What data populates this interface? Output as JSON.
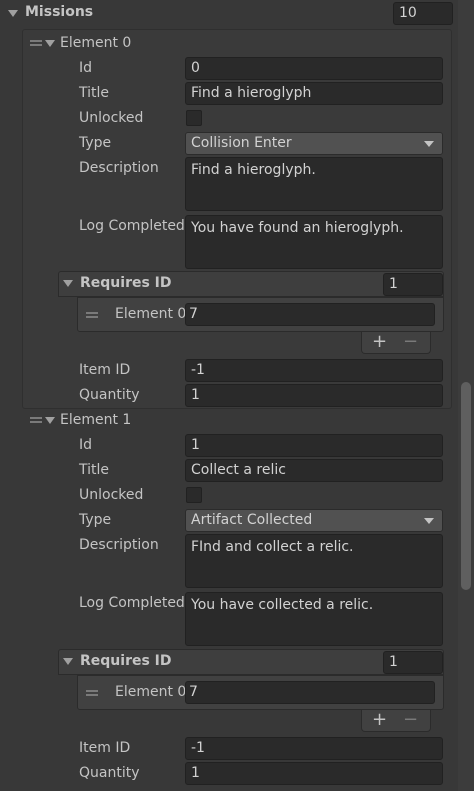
{
  "missions": {
    "label": "Missions",
    "size": "10",
    "elements": [
      {
        "header": "Element 0",
        "id_label": "Id",
        "id_value": "0",
        "title_label": "Title",
        "title_value": "Find a hieroglyph",
        "unlocked_label": "Unlocked",
        "type_label": "Type",
        "type_value": "Collision Enter",
        "description_label": "Description",
        "description_value": "Find a hieroglyph.",
        "log_label": "Log Completed",
        "log_value": "You have found an hieroglyph.",
        "requires": {
          "label": "Requires ID",
          "size": "1",
          "items": [
            {
              "label": "Element 0",
              "value": "7"
            }
          ],
          "add": "+",
          "remove": "−"
        },
        "item_id_label": "Item ID",
        "item_id_value": "-1",
        "quantity_label": "Quantity",
        "quantity_value": "1"
      },
      {
        "header": "Element 1",
        "id_label": "Id",
        "id_value": "1",
        "title_label": "Title",
        "title_value": "Collect a relic",
        "unlocked_label": "Unlocked",
        "type_label": "Type",
        "type_value": "Artifact Collected",
        "description_label": "Description",
        "description_value": "FInd and collect a relic.",
        "log_label": "Log Completed",
        "log_value": "You have collected a relic.",
        "requires": {
          "label": "Requires ID",
          "size": "1",
          "items": [
            {
              "label": "Element 0",
              "value": "7"
            }
          ],
          "add": "+",
          "remove": "−"
        },
        "item_id_label": "Item ID",
        "item_id_value": "-1",
        "quantity_label": "Quantity",
        "quantity_value": "1"
      }
    ]
  },
  "colors": {
    "background": "#383838",
    "field_bg": "#2a2a2a",
    "dropdown_bg": "#515151",
    "text": "#c4c4c4"
  }
}
